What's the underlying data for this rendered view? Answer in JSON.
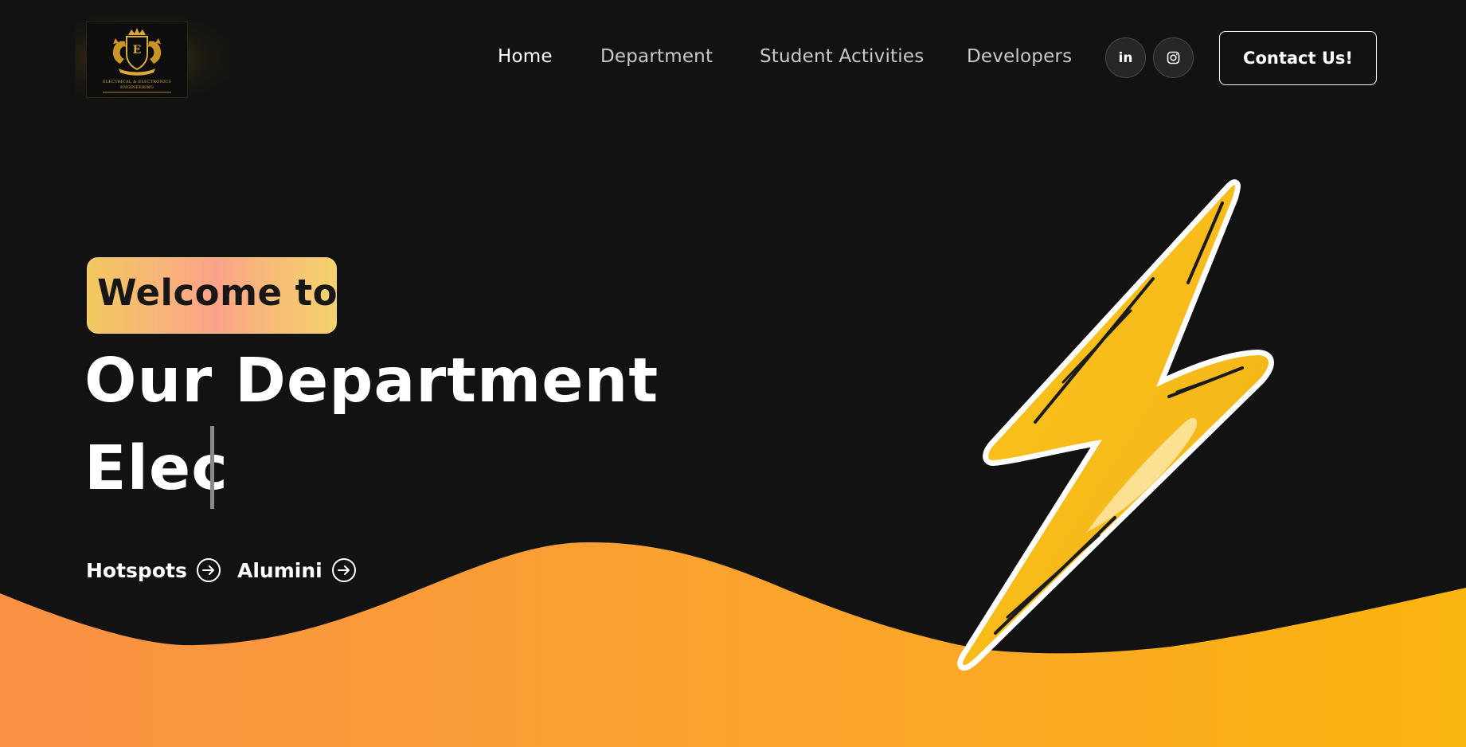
{
  "header": {
    "logo": {
      "line1": "ELECTRICAL & ELECTRONICS",
      "line2": "ENGINEERING",
      "emblem_letter": "E"
    },
    "nav": [
      {
        "label": "Home",
        "active": true
      },
      {
        "label": "Department",
        "active": false
      },
      {
        "label": "Student Activities",
        "active": false
      },
      {
        "label": "Developers",
        "active": false
      }
    ],
    "social": {
      "linkedin_label": "in",
      "linkedin_icon": "linkedin-icon",
      "instagram_icon": "instagram-icon"
    },
    "contact_label": "Contact Us!"
  },
  "hero": {
    "badge": "Welcome to",
    "title": "Our Department",
    "typed_text": "Elec",
    "links": [
      {
        "label": "Hotspots",
        "icon": "arrow-right-circle-icon"
      },
      {
        "label": "Alumini",
        "icon": "arrow-right-circle-icon"
      }
    ],
    "illustration_icon": "lightning-bolt-icon"
  },
  "colors": {
    "background": "#121212",
    "wave_start": "#fa9145",
    "wave_end": "#fbb50f",
    "bolt_fill": "#f9c21a",
    "badge_gradient": [
      "#f2c95e",
      "#fba28a",
      "#f4d26d"
    ],
    "text": "#ffffff"
  }
}
